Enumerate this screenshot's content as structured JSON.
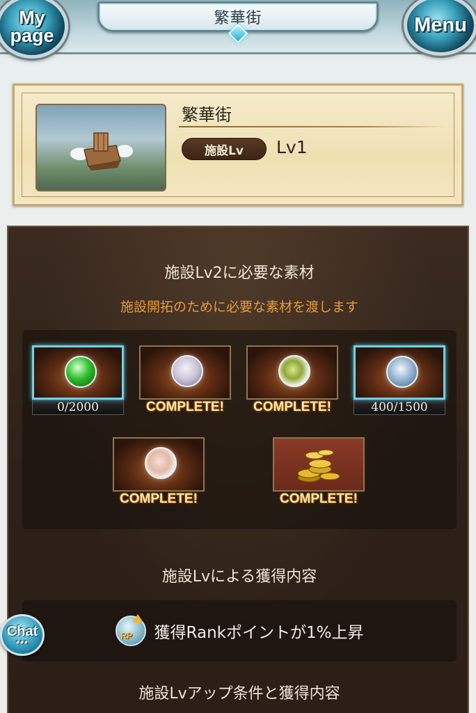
{
  "header": {
    "title": "繁華街",
    "my_page_label": "My page",
    "menu_label": "Menu"
  },
  "facility": {
    "name": "繁華街",
    "level_tag": "施設Lv",
    "level_value": "Lv1"
  },
  "requirements": {
    "heading": "施設Lv2に必要な素材",
    "subheading": "施設開拓のために必要な素材を渡します",
    "materials": [
      {
        "label": "0/2000",
        "status": "count",
        "selected": true,
        "orb_color": "#2fbf2f"
      },
      {
        "label": "COMPLETE!",
        "status": "complete",
        "selected": false,
        "orb_color": "#c9c3d6"
      },
      {
        "label": "COMPLETE!",
        "status": "complete",
        "selected": false,
        "orb_color": "#8fa83a"
      },
      {
        "label": "400/1500",
        "status": "count",
        "selected": true,
        "orb_color": "#8fb0d0"
      },
      {
        "label": "COMPLETE!",
        "status": "complete",
        "selected": false,
        "orb_color": "#e3b9a6"
      },
      {
        "label": "COMPLETE!",
        "status": "complete",
        "selected": false,
        "orb_color": "#d8a628"
      }
    ]
  },
  "benefits": {
    "heading": "施設Lvによる獲得内容",
    "rp_badge": "RP",
    "text": "獲得Rankポイントが1%上昇"
  },
  "conditions": {
    "heading": "施設Lvアップ条件と獲得内容"
  },
  "chat": {
    "label": "Chat",
    "dots": "•••"
  },
  "colors": {
    "accent_orange": "#e69a3c",
    "selected_border": "#72d0e4",
    "complete_text": "#ffe9a6"
  }
}
